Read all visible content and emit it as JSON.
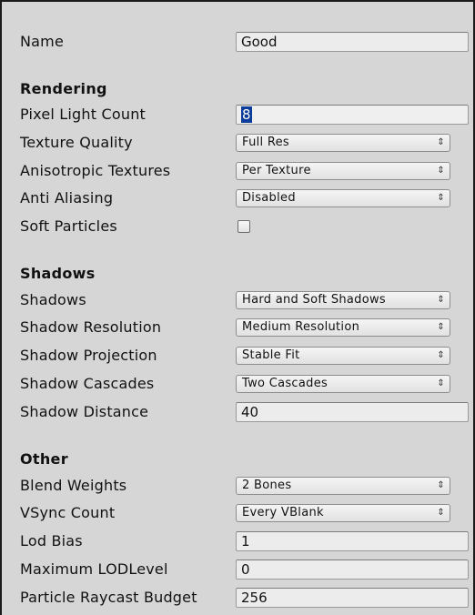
{
  "name_row": {
    "label": "Name",
    "value": "Good"
  },
  "rendering": {
    "header": "Rendering",
    "pixel_light_count": {
      "label": "Pixel Light Count",
      "value": "8"
    },
    "texture_quality": {
      "label": "Texture Quality",
      "value": "Full Res"
    },
    "anisotropic_textures": {
      "label": "Anisotropic Textures",
      "value": "Per Texture"
    },
    "anti_aliasing": {
      "label": "Anti Aliasing",
      "value": "Disabled"
    },
    "soft_particles": {
      "label": "Soft Particles",
      "checked": false
    }
  },
  "shadows": {
    "header": "Shadows",
    "shadows": {
      "label": "Shadows",
      "value": "Hard and Soft Shadows"
    },
    "shadow_resolution": {
      "label": "Shadow Resolution",
      "value": "Medium Resolution"
    },
    "shadow_projection": {
      "label": "Shadow Projection",
      "value": "Stable Fit"
    },
    "shadow_cascades": {
      "label": "Shadow Cascades",
      "value": "Two Cascades"
    },
    "shadow_distance": {
      "label": "Shadow Distance",
      "value": "40"
    }
  },
  "other": {
    "header": "Other",
    "blend_weights": {
      "label": "Blend Weights",
      "value": "2 Bones"
    },
    "vsync_count": {
      "label": "VSync Count",
      "value": "Every VBlank"
    },
    "lod_bias": {
      "label": "Lod Bias",
      "value": "1"
    },
    "maximum_lod_level": {
      "label": "Maximum LODLevel",
      "value": "0"
    },
    "particle_raycast_budget": {
      "label": "Particle Raycast Budget",
      "value": "256"
    }
  },
  "icons": {
    "dropdown_arrow": "updown-arrow-icon",
    "glyph": "⇕"
  },
  "colors": {
    "panel_bg": "#d6d6d6",
    "selection": "#0a3c9e",
    "field_bg": "#ececec"
  }
}
